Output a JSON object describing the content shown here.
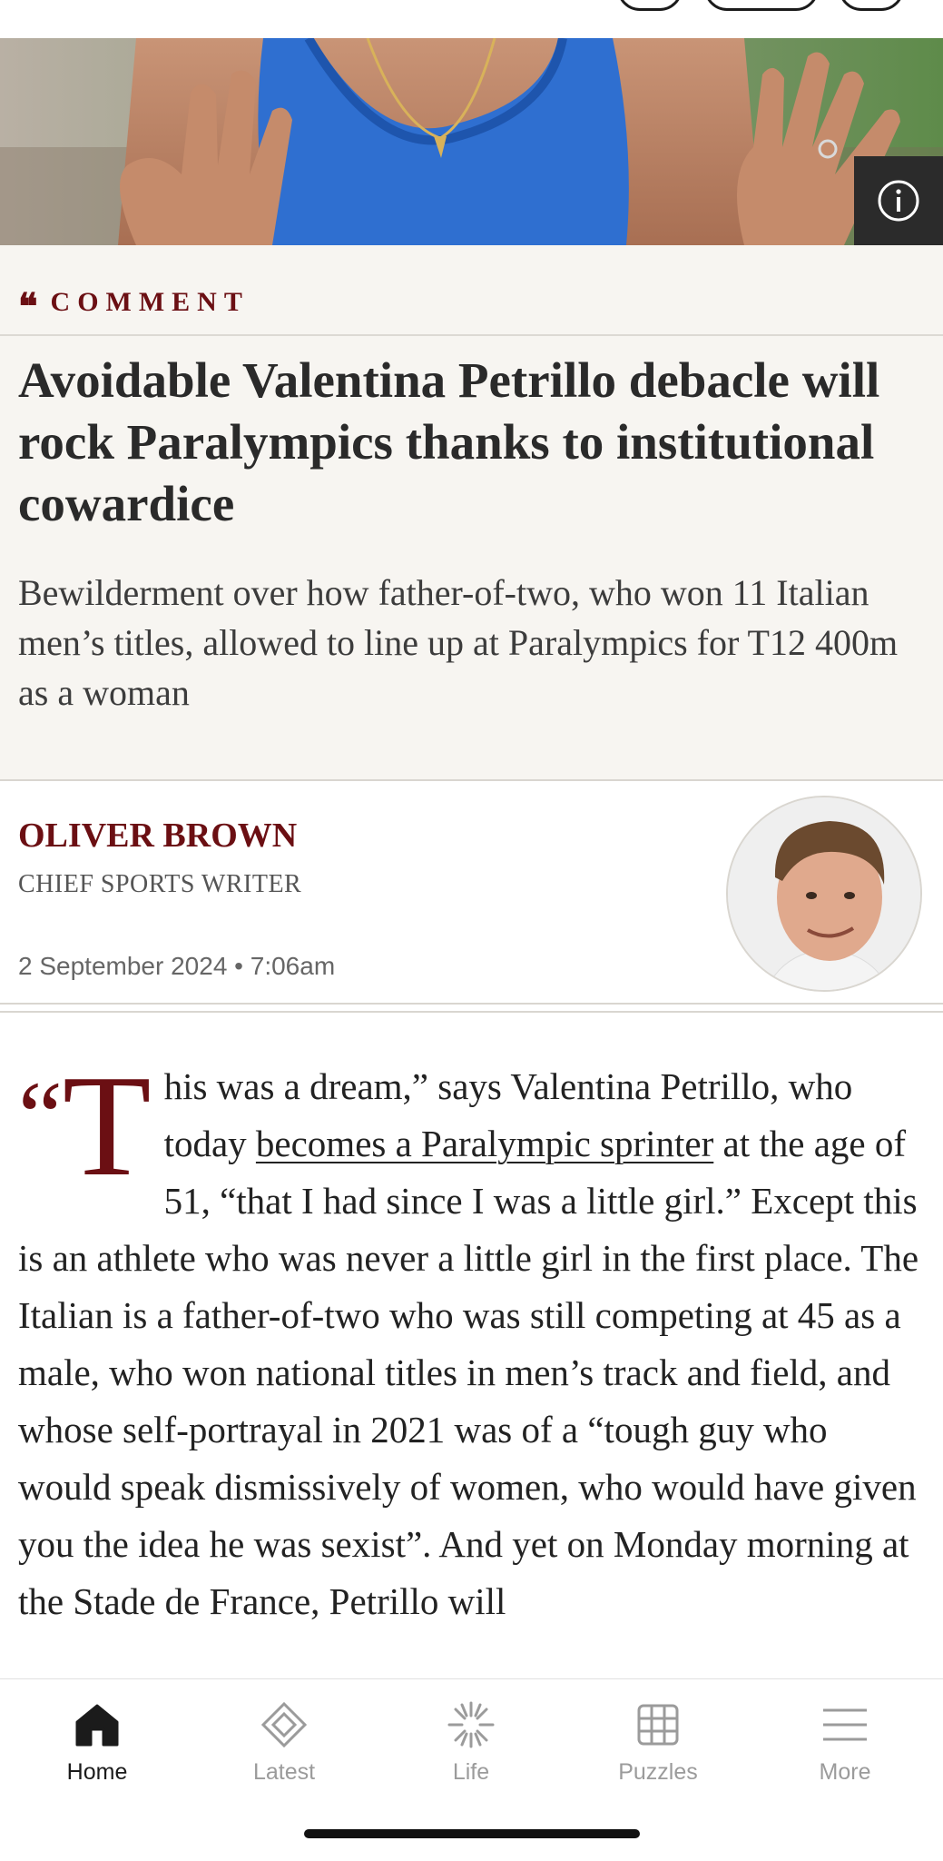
{
  "article": {
    "kicker": "COMMENT",
    "kicker_mark": "❝",
    "headline": "Avoidable Valentina Petrillo debacle will rock Paralympics thanks to institutional cowardice",
    "standfirst": "Bewilderment over how father-of-two, who won 11 Italian men’s titles, allowed to line up at Paralympics for T12 400m as a woman",
    "author": {
      "name": "OLIVER BROWN",
      "role": "CHIEF SPORTS WRITER"
    },
    "date": "2 September 2024 • 7:06am",
    "body": {
      "dropcap_quote": "“",
      "dropcap_letter": "T",
      "text_before_link": "his was a dream,” says Valentina Petrillo, who today ",
      "link_text": "becomes a Paralympic sprinter",
      "text_after_link": " at the age of 51, “that I had since I was a little girl.” Except this is an athlete who was never a little girl in the first place. The Italian is a father-of-two who was still competing at 45 as a male, who won national titles in men’s track and field, and whose self-portrayal in 2021 was of a “tough guy who would speak dismissively of women, who would have given you the idea he was sexist”. And yet on Monday morning at the Stade de France, Petrillo will"
    }
  },
  "colors": {
    "accent": "#6b0f13",
    "header_bg": "#f7f5f1",
    "active_tab": "#1b1b1b",
    "inactive_tab": "#9b9b9b"
  },
  "tabs": [
    {
      "label": "Home",
      "icon": "home-icon",
      "active": true
    },
    {
      "label": "Latest",
      "icon": "diamond-icon",
      "active": false
    },
    {
      "label": "Life",
      "icon": "sparkle-icon",
      "active": false
    },
    {
      "label": "Puzzles",
      "icon": "grid-icon",
      "active": false
    },
    {
      "label": "More",
      "icon": "menu-icon",
      "active": false
    }
  ]
}
